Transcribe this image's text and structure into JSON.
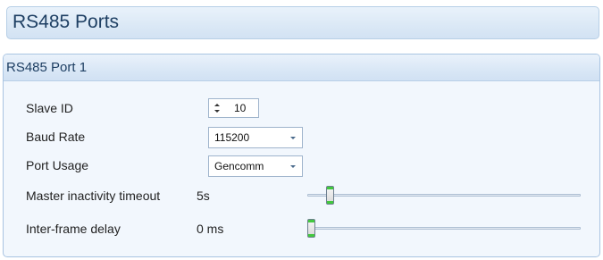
{
  "page": {
    "title": "RS485 Ports"
  },
  "group": {
    "title": "RS485 Port 1",
    "slave_id": {
      "label": "Slave ID",
      "value": "10",
      "icon": "spinner-arrows-icon"
    },
    "baud_rate": {
      "label": "Baud Rate",
      "value": "115200",
      "icon": "chevron-down-icon"
    },
    "port_usage": {
      "label": "Port Usage",
      "value": "Gencomm",
      "icon": "chevron-down-icon"
    },
    "master_inactivity_timeout": {
      "label": "Master inactivity timeout",
      "value": "5s",
      "level": 0.07
    },
    "inter_frame_delay": {
      "label": "Inter-frame delay",
      "value": "0 ms",
      "level": 0.0
    }
  },
  "colors": {
    "slider_thumb_accent": "#43c83f",
    "header_text": "#1e3f63",
    "panel_background": "#f2f7fd"
  }
}
